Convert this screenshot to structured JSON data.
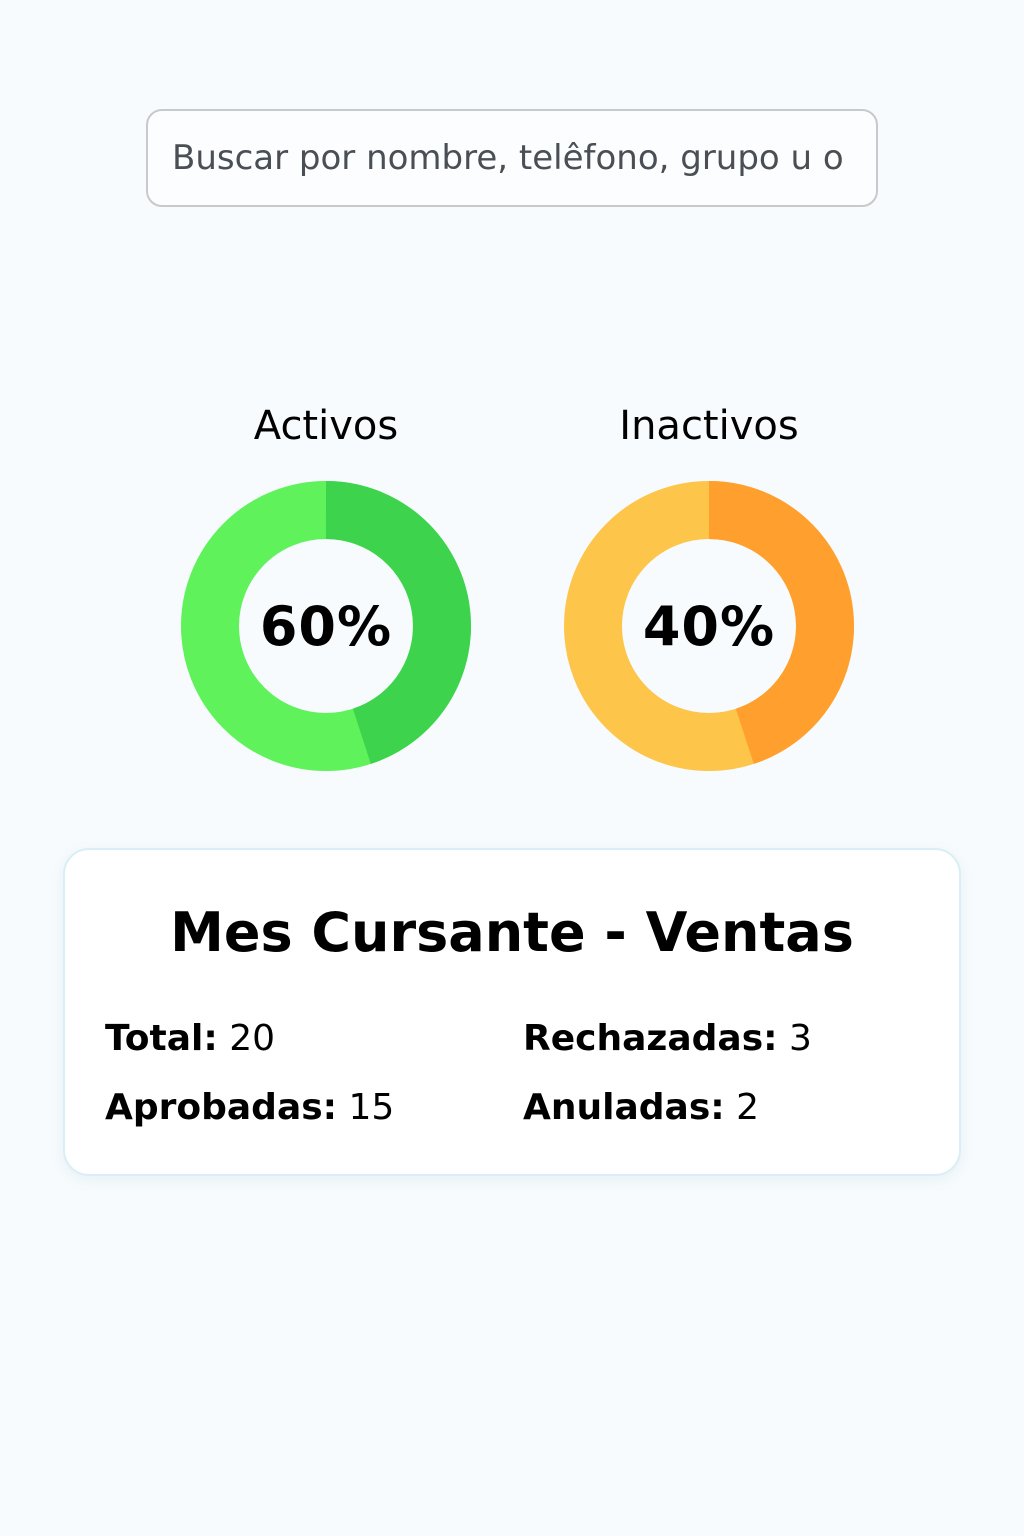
{
  "search": {
    "placeholder": "Buscar por nombre, telêfono, grupo u o o"
  },
  "charts": {
    "activos": {
      "title": "Activos",
      "percent": 60,
      "label": "60%",
      "colors": {
        "light": "#5ff25a",
        "dark": "#3dd34d"
      }
    },
    "inactivos": {
      "title": "Inactivos",
      "percent": 40,
      "label": "40%",
      "colors": {
        "light": "#fdc54a",
        "dark": "#ff9f2e"
      }
    }
  },
  "chart_data": [
    {
      "type": "pie",
      "title": "Activos",
      "center_label": "60%",
      "values": [
        60
      ]
    },
    {
      "type": "pie",
      "title": "Inactivos",
      "center_label": "40%",
      "values": [
        40
      ]
    }
  ],
  "summary": {
    "title": "Mes Cursante - Ventas",
    "total": {
      "label": "Total:",
      "value": "20"
    },
    "rechazadas": {
      "label": "Rechazadas:",
      "value": "3"
    },
    "aprobadas": {
      "label": "Aprobadas:",
      "value": "15"
    },
    "anuladas": {
      "label": "Anuladas:",
      "value": "2"
    }
  }
}
